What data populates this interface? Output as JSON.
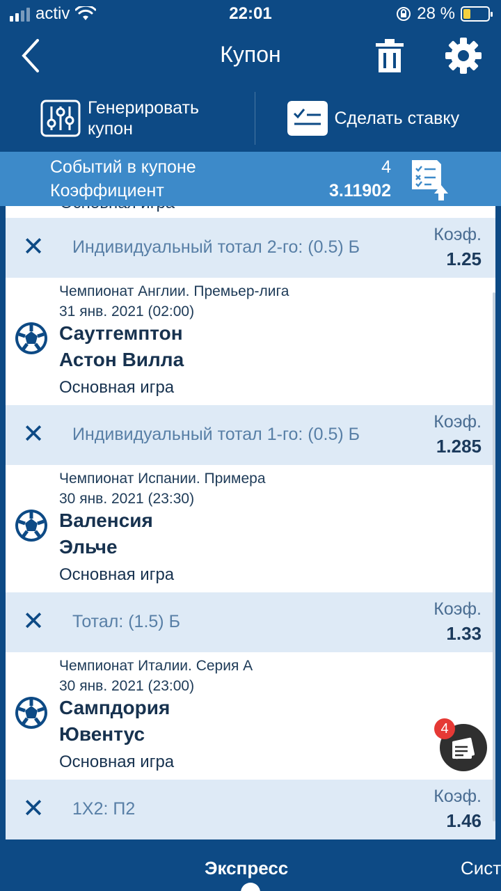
{
  "status_bar": {
    "carrier": "activ",
    "time": "22:01",
    "battery_percent": "28 %",
    "battery_level": 0.28
  },
  "header": {
    "title": "Купон",
    "icons": [
      "back-icon",
      "trash-icon",
      "gear-icon"
    ]
  },
  "actions": {
    "generate_label": "Генерировать купон",
    "generate_line1": "Генерировать",
    "generate_line2": "купон",
    "make_bet_label": "Сделать ставку"
  },
  "summary": {
    "events_label": "Событий в купоне",
    "events_count": "4",
    "coef_label": "Коэффициент",
    "coef_value": "3.11902"
  },
  "partial_row": {
    "game_type": "Основная игра"
  },
  "bets": [
    {
      "market": "Индивидуальный тотал 2-го: (0.5) Б",
      "coef_label": "Коэф.",
      "coef": "1.25"
    },
    {
      "market": "Индивидуальный тотал 1-го: (0.5) Б",
      "coef_label": "Коэф.",
      "coef": "1.285"
    },
    {
      "market": "Тотал: (1.5) Б",
      "coef_label": "Коэф.",
      "coef": "1.33"
    },
    {
      "market": "1X2: П2",
      "coef_label": "Коэф.",
      "coef": "1.46"
    }
  ],
  "matches": [
    {
      "league": "Чемпионат Англии. Премьер-лига",
      "date": "31 янв. 2021 (02:00)",
      "team1": "Саутгемптон",
      "team2": "Астон Вилла",
      "game_type": "Основная игра"
    },
    {
      "league": "Чемпионат Испании. Примера",
      "date": "30 янв. 2021 (23:30)",
      "team1": "Валенсия",
      "team2": "Эльче",
      "game_type": "Основная игра"
    },
    {
      "league": "Чемпионат Италии. Серия А",
      "date": "30 янв. 2021 (23:00)",
      "team1": "Сампдория",
      "team2": "Ювентус",
      "game_type": "Основная игра"
    }
  ],
  "fab": {
    "badge": "4"
  },
  "tabs": {
    "express": "Экспресс",
    "system": "Сист"
  },
  "colors": {
    "primary": "#0d4a85",
    "summary_bg": "#3d8ac9",
    "bet_bg": "#deeaf6",
    "badge": "#e53935"
  }
}
